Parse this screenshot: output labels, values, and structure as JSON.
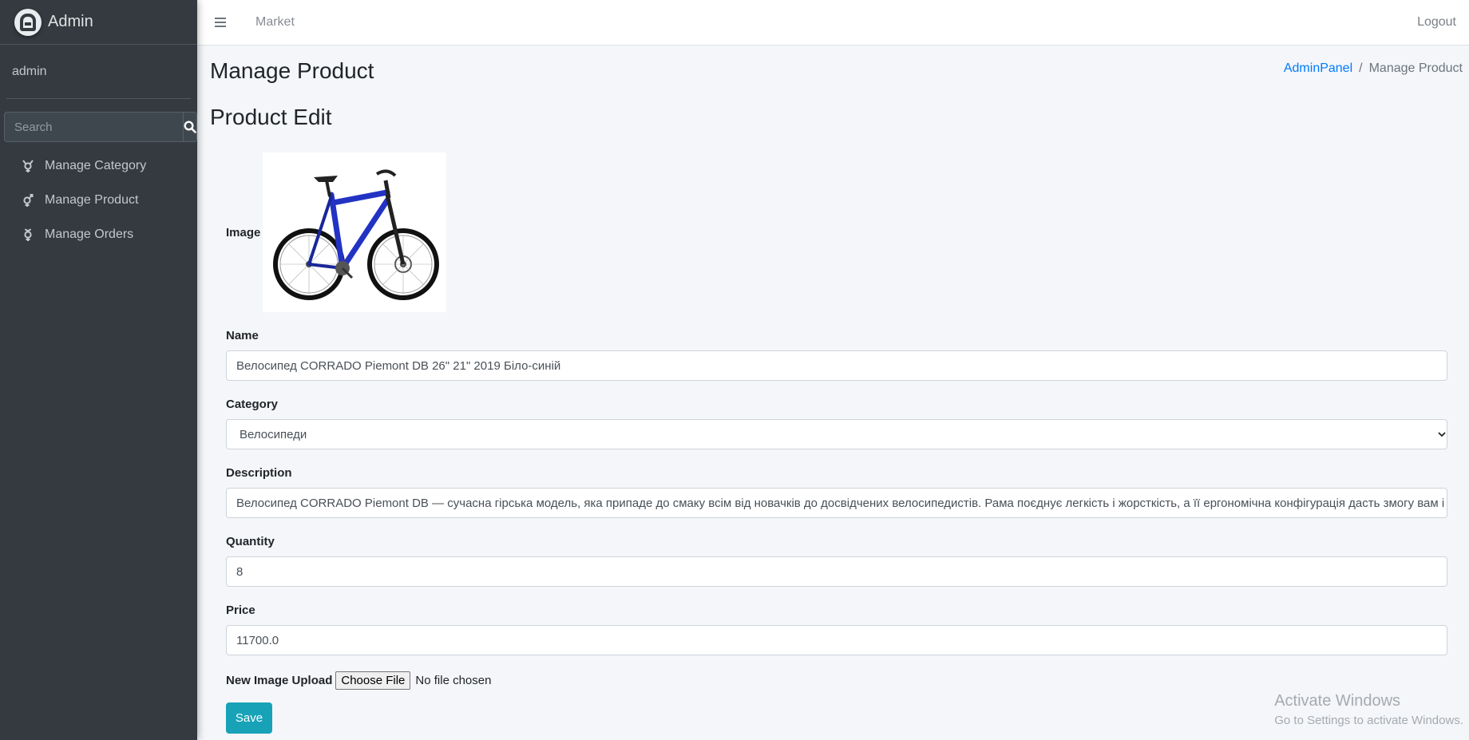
{
  "brand": {
    "name": "Admin"
  },
  "user": {
    "name": "admin"
  },
  "search": {
    "placeholder": "Search"
  },
  "sidebar": {
    "items": [
      {
        "label": "Manage Category",
        "icon": "transgender-icon"
      },
      {
        "label": "Manage Product",
        "icon": "mercury-icon"
      },
      {
        "label": "Manage Orders",
        "icon": "mercury-alt-icon"
      }
    ]
  },
  "navbar": {
    "market": "Market",
    "logout": "Logout"
  },
  "page": {
    "title": "Manage Product",
    "breadcrumb": {
      "root": "AdminPanel",
      "separator": "/",
      "current": "Manage Product"
    },
    "section_title": "Product Edit"
  },
  "form": {
    "image_label": "Image",
    "name_label": "Name",
    "name_value": "Велосипед CORRADO Piemont DB 26\" 21\" 2019 Біло-синій",
    "category_label": "Category",
    "category_value": "Велосипеди",
    "description_label": "Description",
    "description_value": "Велосипед CORRADO Piemont DB — сучасна гірська модель, яка припаде до смаку всім від новачків до досвідчених велосипедистів. Рама поєднує легкість і жорсткість, а її ергономічна конфігурація дасть змогу вам і",
    "quantity_label": "Quantity",
    "quantity_value": "8",
    "price_label": "Price",
    "price_value": "11700.0",
    "upload_label": "New Image Upload",
    "choose_file": "Choose File",
    "no_file": "No file chosen",
    "save": "Save"
  },
  "watermark": {
    "title": "Activate Windows",
    "subtitle": "Go to Settings to activate Windows."
  },
  "colors": {
    "sidebar_bg": "#343a40",
    "accent_link": "#007bff",
    "save_button": "#17a2b8",
    "bike_frame": "#2233c4"
  }
}
